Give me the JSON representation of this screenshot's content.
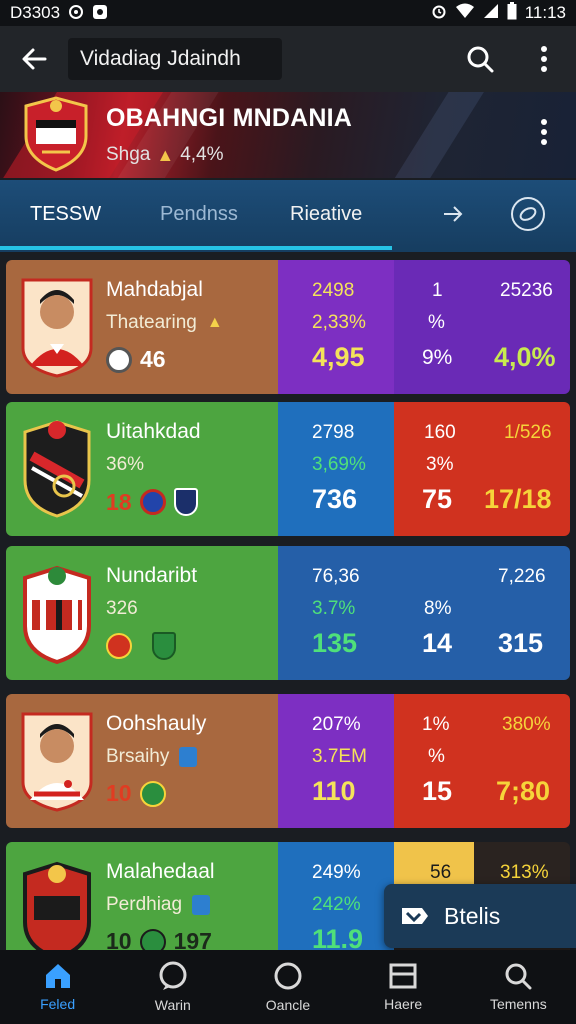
{
  "status_bar": {
    "time_left": "D3303",
    "time_right": "11:13"
  },
  "app_bar": {
    "search_value": "Vidadiag Jdaindh"
  },
  "banner": {
    "club_name": "OBAHNGI MNDANIA",
    "sub_label": "Shga",
    "sub_value": "4,4%"
  },
  "tabs": [
    {
      "label": "TESSW"
    },
    {
      "label": "Pendnss"
    },
    {
      "label": "Rieative"
    }
  ],
  "rows": [
    {
      "name": "Mahdabjal",
      "sub": "Thatearing",
      "bottom": "46",
      "colors": {
        "left": "#a8683f",
        "c1": "#7d2fc2",
        "c2": "#6a2ab6"
      },
      "c1": [
        "2498",
        "2,33%",
        "4,95"
      ],
      "c2a": [
        "1",
        "%",
        "9%"
      ],
      "c2b": [
        "25236",
        "",
        "4,0%"
      ]
    },
    {
      "name": "Uitahkdad",
      "sub": "36%",
      "bottom": "18",
      "colors": {
        "left": "#4da540",
        "c1": "#1f6fbd",
        "c2": "#d0321f"
      },
      "c1": [
        "2798",
        "3,69%",
        "736"
      ],
      "c2a": [
        "160",
        "3%",
        "75"
      ],
      "c2b": [
        "1/526",
        "",
        "17/18"
      ]
    },
    {
      "name": "Nundaribt",
      "sub": "326",
      "bottom": "",
      "colors": {
        "left": "#4da540",
        "c1": "#255fa8",
        "c2": "#255fa8"
      },
      "c1": [
        "76,36",
        "3.7%",
        "135"
      ],
      "c2a": [
        "",
        "8%",
        "14"
      ],
      "c2b": [
        "7,226",
        "",
        "315"
      ]
    },
    {
      "name": "Oohshauly",
      "sub": "Brsaihy",
      "bottom": "10",
      "colors": {
        "left": "#a8683f",
        "c1": "#7d2fc2",
        "c2": "#d0321f"
      },
      "c1": [
        "207%",
        "3.7EM",
        "110"
      ],
      "c2a": [
        "1%",
        "%",
        "15"
      ],
      "c2b": [
        "380%",
        "",
        "7;80"
      ]
    },
    {
      "name": "Malahedaal",
      "sub": "Perdhiag",
      "bottom": "10",
      "bottom_extra": "197",
      "colors": {
        "left": "#4da540",
        "c1": "#1f6fbd",
        "c2": "#2a2320",
        "c2_highlight": "#f0c34a"
      },
      "c1": [
        "249%",
        "242%",
        "11.9"
      ],
      "c2a": [
        "56",
        "",
        ""
      ],
      "c2b": [
        "313%",
        "",
        ""
      ]
    }
  ],
  "fab": {
    "label": "Btelis"
  },
  "bottom_nav": [
    {
      "label": "Feled",
      "icon": "home-icon"
    },
    {
      "label": "Warin",
      "icon": "chat-icon"
    },
    {
      "label": "Oancle",
      "icon": "circle-icon"
    },
    {
      "label": "Haere",
      "icon": "list-icon"
    },
    {
      "label": "Temenns",
      "icon": "search-icon"
    }
  ],
  "accent_color": "#26c3e6"
}
